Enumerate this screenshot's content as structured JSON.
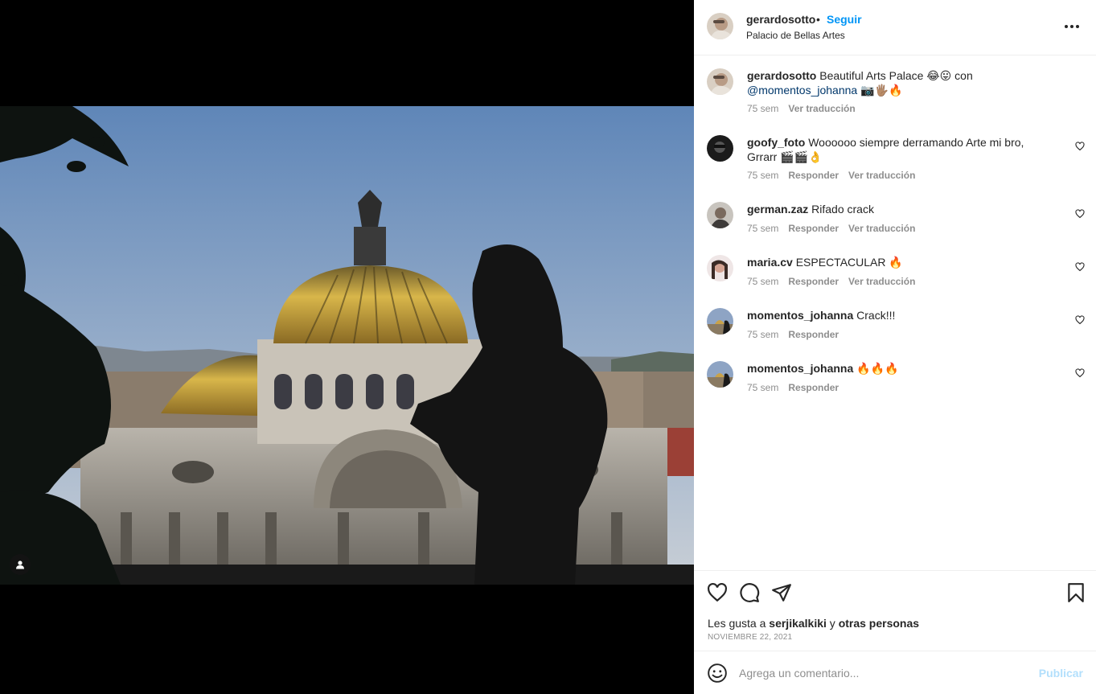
{
  "post": {
    "author": "gerardosotto",
    "dot": "•",
    "follow_label": "Seguir",
    "location": "Palacio de Bellas Artes"
  },
  "caption": {
    "username": "gerardosotto",
    "text": "Beautiful Arts Palace 😂😛 con",
    "mention": "@momentos_johanna",
    "trailing_emoji": "📷🖐🏽🔥",
    "time": "75 sem",
    "translate": "Ver traducción"
  },
  "comments": [
    {
      "username": "goofy_foto",
      "text": "Woooooo siempre derramando Arte mi bro, Grrarr 🎬🎬👌",
      "time": "75 sem",
      "reply": "Responder",
      "translate": "Ver traducción"
    },
    {
      "username": "german.zaz",
      "text": "Rifado crack",
      "time": "75 sem",
      "reply": "Responder",
      "translate": "Ver traducción"
    },
    {
      "username": "maria.cv",
      "text": "ESPECTACULAR 🔥",
      "time": "75 sem",
      "reply": "Responder",
      "translate": "Ver traducción"
    },
    {
      "username": "momentos_johanna",
      "text": "Crack!!!",
      "time": "75 sem",
      "reply": "Responder",
      "translate": ""
    },
    {
      "username": "momentos_johanna",
      "text": "🔥🔥🔥",
      "time": "75 sem",
      "reply": "Responder",
      "translate": ""
    }
  ],
  "likes": {
    "prefix": "Les gusta a",
    "user": "serjikalkiki",
    "conj": "y",
    "others": "otras personas"
  },
  "date": "NOVIEMBRE 22, 2021",
  "add_comment": {
    "placeholder": "Agrega un comentario...",
    "publish_label": "Publicar"
  },
  "icons": {
    "like": "heart-icon",
    "comment": "comment-icon",
    "share": "share-icon",
    "save": "bookmark-icon",
    "more": "more-options-icon",
    "emoji": "emoji-icon",
    "tag": "user-tag-icon"
  },
  "colors": {
    "accent": "#0095f6",
    "mention": "#00376b",
    "muted": "#8e8e8e",
    "publish_disabled": "#b2dffc"
  }
}
